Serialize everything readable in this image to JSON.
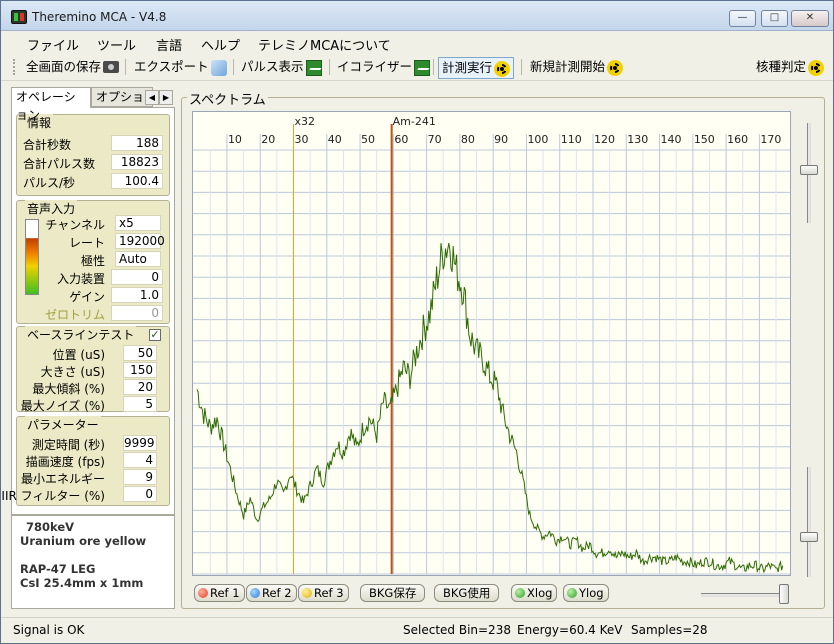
{
  "window": {
    "title": "Theremino MCA - V4.8",
    "controls": {
      "minimize": "—",
      "maximize": "□",
      "close": "✕"
    }
  },
  "menu": {
    "file": "ファイル",
    "tools": "ツール",
    "language": "言語",
    "help": "ヘルプ",
    "about": "テレミノMCAについて"
  },
  "toolbar": {
    "save_all": "全画面の保存",
    "export": "エクスポート",
    "pulse_display": "パルス表示",
    "equalizer": "イコライザー",
    "run_measurement": "計測実行",
    "new_measurement": "新規計測開始",
    "nuclide_id": "核種判定"
  },
  "tabs": {
    "operation": "オペレーション",
    "options": "オプション",
    "prev": "◀",
    "next": "▶"
  },
  "info_group": {
    "title": "情報",
    "total_seconds_label": "合計秒数",
    "total_seconds": "188",
    "total_pulses_label": "合計パルス数",
    "total_pulses": "18823",
    "pulses_per_sec_label": "パルス/秒",
    "pulses_per_sec": "100.4"
  },
  "audio_group": {
    "title": "音声入力",
    "channel_label": "チャンネル",
    "channel": "x5",
    "rate_label": "レート",
    "rate": "192000",
    "polarity_label": "極性",
    "polarity": "Auto",
    "input_device_label": "入力装置",
    "input_device": "0",
    "gain_label": "ゲイン",
    "gain": "1.0",
    "zero_trim_label": "ゼロトリム",
    "zero_trim": "0",
    "level_fraction": 0.75
  },
  "baseline_group": {
    "title": "ベースラインテスト",
    "checked": "✓",
    "position_label": "位置 (uS)",
    "position": "50",
    "size_label": "大きさ (uS)",
    "size": "150",
    "max_slope_label": "最大傾斜 (%)",
    "max_slope": "20",
    "max_noise_label": "最大ノイズ (%)",
    "max_noise": "5"
  },
  "param_group": {
    "title": "パラメーター",
    "meas_time_label": "測定時間 (秒)",
    "meas_time": "9999",
    "draw_speed_label": "描画速度 (fps)",
    "draw_speed": "4",
    "min_energy_label": "最小エネルギー",
    "min_energy": "9",
    "iir_label": "IIR フィルター (%)",
    "iir": "0"
  },
  "notes": {
    "line1": "780keV",
    "line2": "Uranium ore yellow",
    "line3": "",
    "line4": "RAP-47 LEG",
    "line5": "CsI 25.4mm x 1mm"
  },
  "spectrum": {
    "title": "スペクトラム",
    "marker1": "x32",
    "marker2": "Am-241",
    "buttons": {
      "ref1": "Ref 1",
      "ref2": "Ref 2",
      "ref3": "Ref 3",
      "bkg_save": "BKG保存",
      "bkg_use": "BKG使用",
      "xlog": "Xlog",
      "ylog": "Ylog"
    }
  },
  "status": {
    "signal": "Signal is OK",
    "selected_bin": "Selected Bin=238",
    "energy": "Energy=60.4 KeV",
    "samples": "Samples=28"
  },
  "colors": {
    "trace": "#2e6b00",
    "marker1": "#f0a020",
    "marker2": "#c05010",
    "grid": "#bcc8da",
    "plot_bg": "#fffff4"
  },
  "chart_data": {
    "type": "line",
    "title": "",
    "xlabel": "",
    "ylabel": "",
    "x_ticks": [
      10,
      20,
      30,
      40,
      50,
      60,
      70,
      80,
      90,
      100,
      110,
      120,
      130,
      140,
      150,
      160,
      170
    ],
    "xlim": [
      1,
      178
    ],
    "ylim": [
      0,
      100
    ],
    "markers": [
      {
        "label": "x32",
        "x": 30
      },
      {
        "label": "Am-241",
        "x": 59.5
      }
    ],
    "series": [
      {
        "x": [
          1,
          3,
          5,
          7,
          9,
          11,
          13,
          15,
          17,
          19,
          21,
          23,
          25,
          27,
          29,
          31,
          33,
          35,
          37,
          39,
          41,
          43,
          45,
          47,
          49,
          51,
          53,
          55,
          57,
          59,
          61,
          63,
          65,
          67,
          69,
          71,
          73,
          75,
          77,
          79,
          81,
          83,
          85,
          87,
          89,
          91,
          93,
          95,
          97,
          99,
          101,
          103,
          105,
          107,
          109,
          111,
          113,
          115,
          117,
          119,
          121,
          123,
          125,
          127,
          129,
          131,
          133,
          135,
          137,
          139,
          141,
          143,
          145,
          147,
          149,
          151,
          153,
          155,
          157,
          159,
          161,
          163,
          165,
          167,
          169,
          171,
          173,
          175,
          177
        ],
        "values": [
          44,
          38,
          35,
          37,
          31,
          25,
          19,
          14,
          18,
          13,
          16,
          18,
          22,
          19,
          24,
          20,
          17,
          21,
          25,
          22,
          27,
          31,
          29,
          34,
          30,
          35,
          37,
          33,
          41,
          39,
          44,
          49,
          47,
          53,
          58,
          62,
          70,
          77,
          79,
          72,
          68,
          57,
          53,
          51,
          47,
          45,
          38,
          33,
          29,
          22,
          14,
          11,
          9,
          10,
          8,
          9,
          7,
          8,
          6,
          7,
          5,
          5,
          6,
          4,
          5,
          4,
          5,
          3,
          4,
          4,
          3,
          3,
          4,
          3,
          3,
          2,
          3,
          3,
          2,
          2,
          3,
          2,
          1,
          2,
          2,
          1,
          2,
          1,
          2
        ]
      }
    ]
  }
}
